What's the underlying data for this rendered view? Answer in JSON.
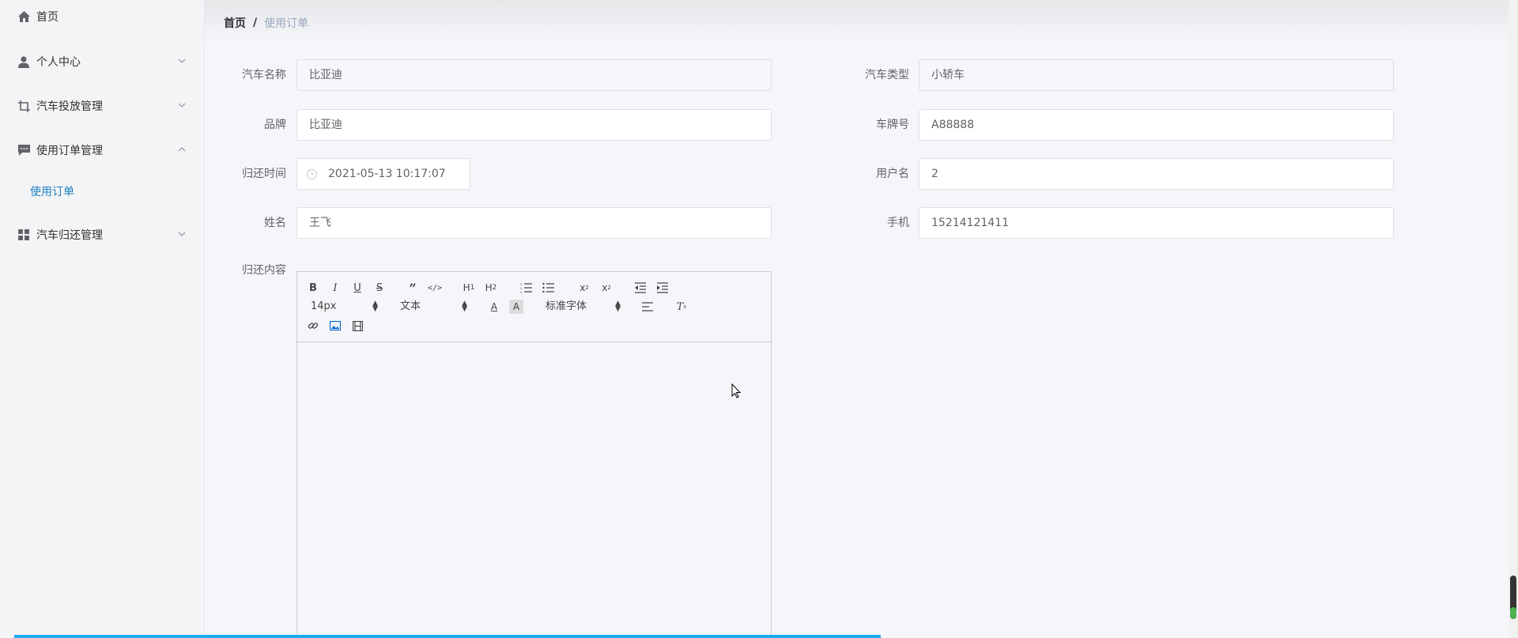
{
  "sidebar": {
    "items": [
      {
        "label": "首页",
        "icon": "home-icon"
      },
      {
        "label": "个人中心",
        "icon": "user-icon"
      },
      {
        "label": "汽车投放管理",
        "icon": "crop-icon"
      },
      {
        "label": "使用订单管理",
        "icon": "message-icon"
      },
      {
        "label": "汽车归还管理",
        "icon": "grid-icon"
      }
    ],
    "sub_items": [
      {
        "label": "使用订单"
      }
    ],
    "accent_color": "#1e80c2"
  },
  "breadcrumb": {
    "home": "首页",
    "separator": "/",
    "current": "使用订单"
  },
  "form": {
    "car_name": {
      "label": "汽车名称",
      "value": "比亚迪"
    },
    "car_type": {
      "label": "汽车类型",
      "value": "小轿车"
    },
    "brand": {
      "label": "品牌",
      "value": "比亚迪"
    },
    "plate": {
      "label": "车牌号",
      "value": "A88888"
    },
    "return_time": {
      "label": "归还时间",
      "value": "2021-05-13 10:17:07"
    },
    "username": {
      "label": "用户名",
      "value": "2"
    },
    "name": {
      "label": "姓名",
      "value": "王飞"
    },
    "phone": {
      "label": "手机",
      "value": "15214121411"
    },
    "return_content": {
      "label": "归还内容"
    }
  },
  "editor": {
    "size": "14px",
    "header": "文本",
    "font": "标准字体"
  }
}
